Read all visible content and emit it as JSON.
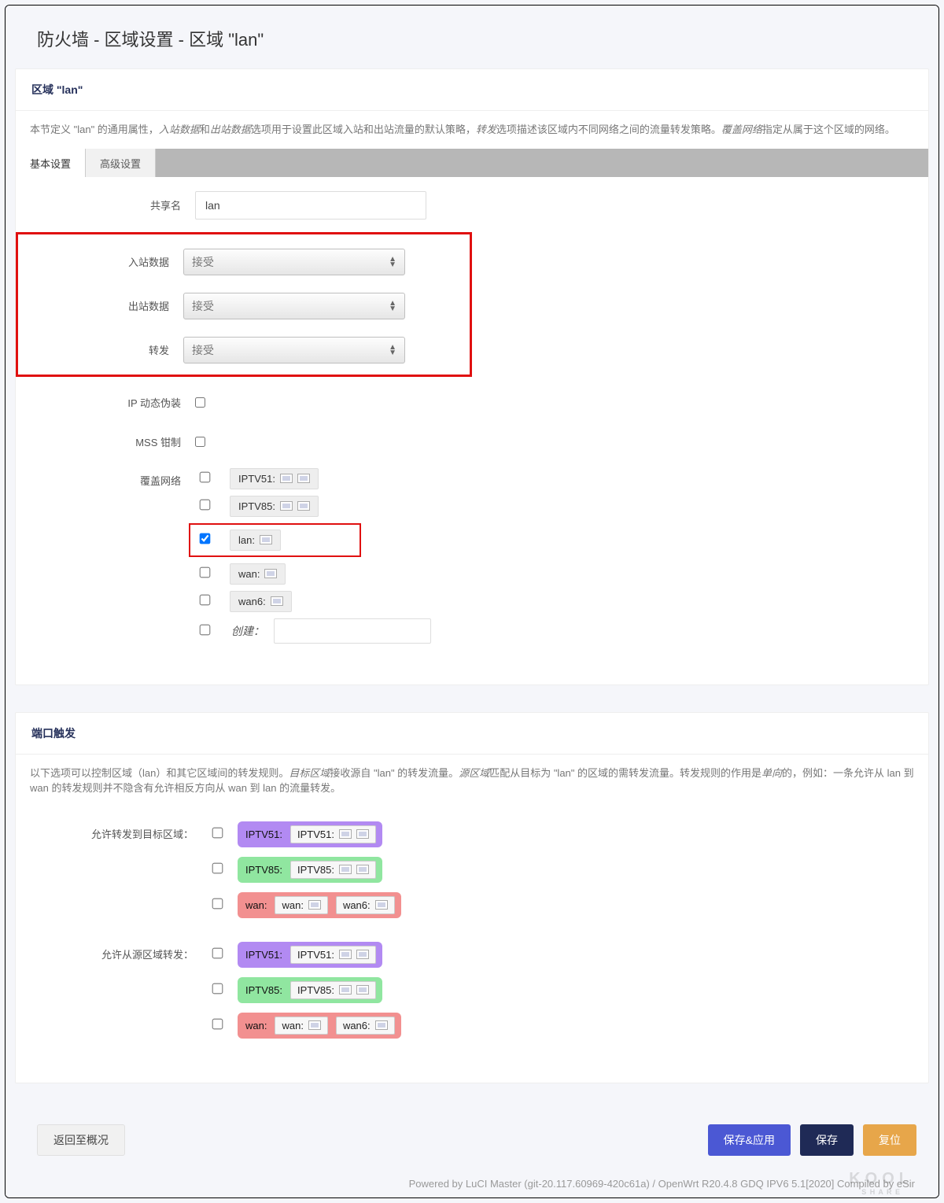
{
  "page_title": "防火墙 - 区域设置 - 区域 \"lan\"",
  "zone_panel": {
    "header": "区域 \"lan\"",
    "description_parts": [
      "本节定义 \"lan\" 的通用属性，",
      "入站数据",
      "和",
      "出站数据",
      "选项用于设置此区域入站和出站流量的默认策略，",
      "转发",
      "选项描述该区域内不同网络之间的流量转发策略。",
      "覆盖网络",
      "指定从属于这个区域的网络。"
    ]
  },
  "tabs": {
    "basic": "基本设置",
    "advanced": "高级设置"
  },
  "form": {
    "name_label": "共享名",
    "name_value": "lan",
    "input_label": "入站数据",
    "input_value": "接受",
    "output_label": "出站数据",
    "output_value": "接受",
    "forward_label": "转发",
    "forward_value": "接受",
    "masq_label": "IP 动态伪装",
    "masq_checked": false,
    "mss_label": "MSS 钳制",
    "mss_checked": false,
    "networks_label": "覆盖网络",
    "networks": [
      {
        "label": "IPTV51:",
        "checked": false,
        "icons": 2
      },
      {
        "label": "IPTV85:",
        "checked": false,
        "icons": 2
      },
      {
        "label": "lan:",
        "checked": true,
        "icons": 1
      },
      {
        "label": "wan:",
        "checked": false,
        "icons": 1
      },
      {
        "label": "wan6:",
        "checked": false,
        "icons": 1
      }
    ],
    "create_label": "创建："
  },
  "port_panel": {
    "header": "端口触发",
    "description_parts": [
      "以下选项可以控制区域（lan）和其它区域间的转发规则。",
      "目标区域",
      "接收源自 \"lan\" 的转发流量。",
      "源区域",
      "匹配从目标为 \"lan\" 的区域的需转发流量。转发规则的作用是",
      "单向",
      "的，例如：一条允许从 lan 到 wan 的转发规则并不隐含有允许相反方向从 wan 到 lan 的流量转发。"
    ]
  },
  "fwd": {
    "dest_label": "允许转发到目标区域：",
    "src_label": "允许从源区域转发：",
    "rows_dest": [
      {
        "zone": "IPTV51:",
        "class": "zc-iptv51",
        "subs": [
          {
            "t": "IPTV51:",
            "icons": 2
          }
        ]
      },
      {
        "zone": "IPTV85:",
        "class": "zc-iptv85",
        "subs": [
          {
            "t": "IPTV85:",
            "icons": 2
          }
        ]
      },
      {
        "zone": "wan:",
        "class": "zc-wan",
        "subs": [
          {
            "t": "wan:",
            "icons": 1
          },
          {
            "t": "wan6:",
            "icons": 1
          }
        ]
      }
    ],
    "rows_src": [
      {
        "zone": "IPTV51:",
        "class": "zc-iptv51",
        "subs": [
          {
            "t": "IPTV51:",
            "icons": 2
          }
        ]
      },
      {
        "zone": "IPTV85:",
        "class": "zc-iptv85",
        "subs": [
          {
            "t": "IPTV85:",
            "icons": 2
          }
        ]
      },
      {
        "zone": "wan:",
        "class": "zc-wan",
        "subs": [
          {
            "t": "wan:",
            "icons": 1
          },
          {
            "t": "wan6:",
            "icons": 1
          }
        ]
      }
    ]
  },
  "actions": {
    "back": "返回至概况",
    "save_apply": "保存&应用",
    "save": "保存",
    "reset": "复位"
  },
  "footer": "Powered by LuCI Master (git-20.117.60969-420c61a) / OpenWrt R20.4.8 GDQ IPV6 5.1[2020] Compiled by eSir",
  "watermark": "KOOL",
  "watermark_sub": "S H A R E"
}
